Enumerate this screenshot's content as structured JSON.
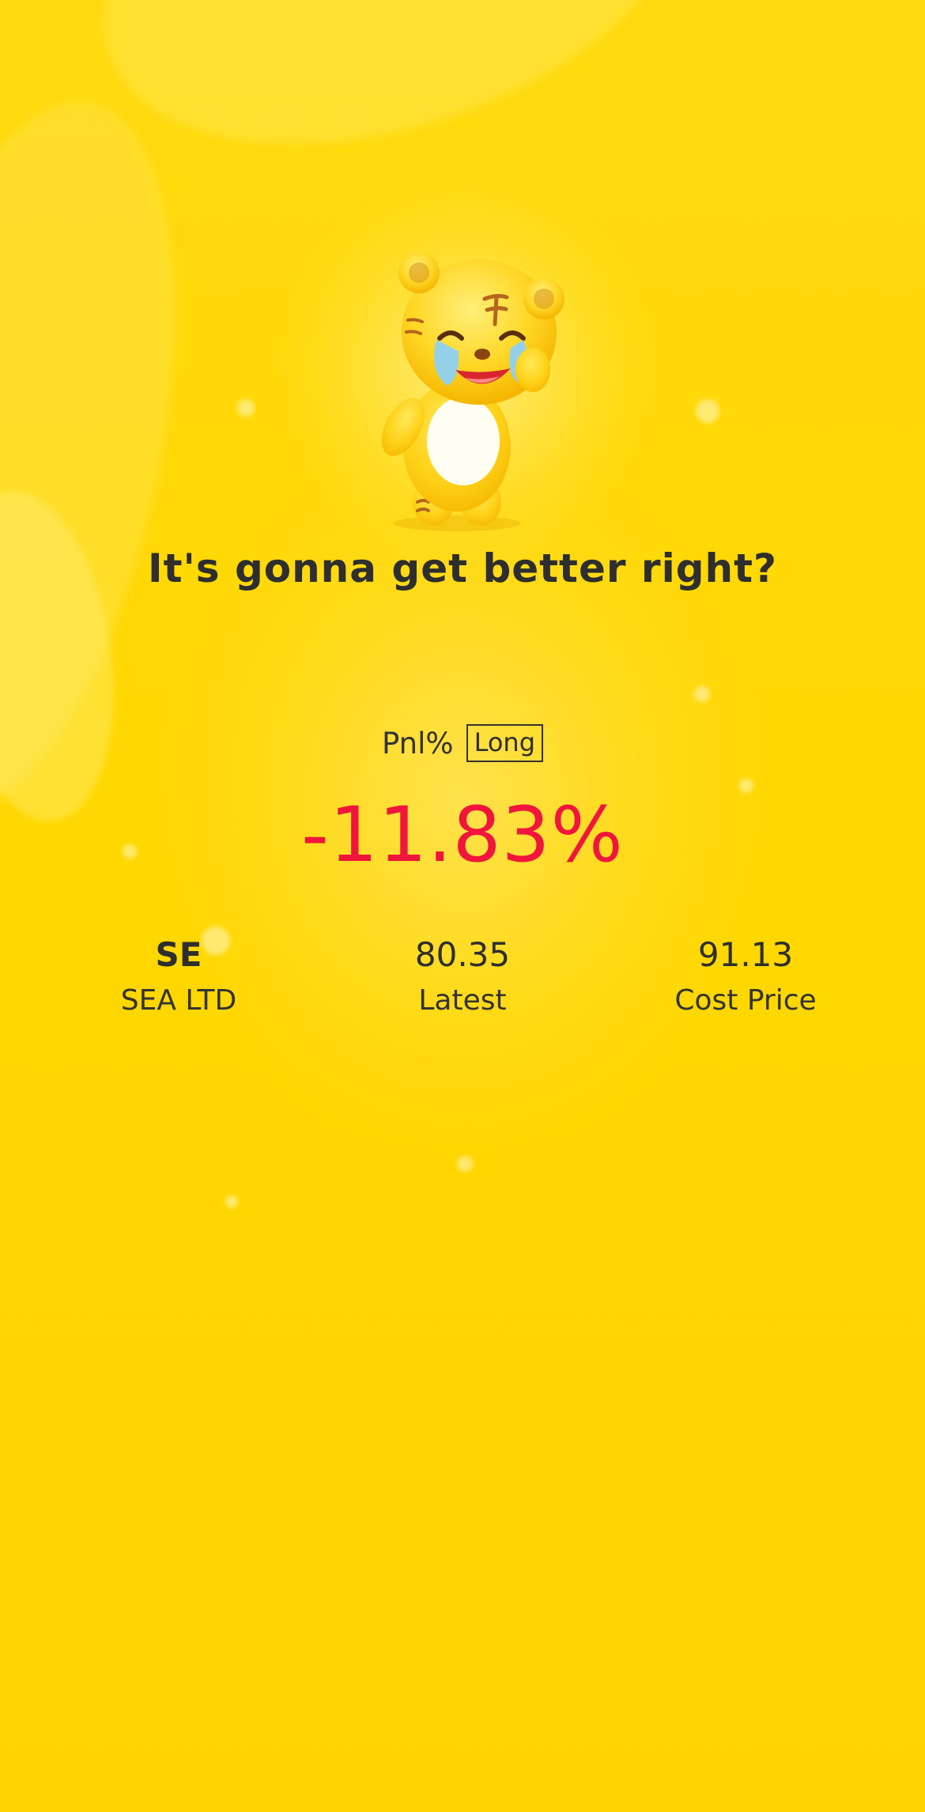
{
  "headline": "It's gonna get better right?",
  "pnl": {
    "label": "Pnl%",
    "position_type": "Long",
    "value": "-11.83%",
    "value_color": "#f0153c"
  },
  "stats": {
    "symbol": "SE",
    "company": "SEA LTD",
    "latest_value": "80.35",
    "latest_label": "Latest",
    "cost_value": "91.13",
    "cost_label": "Cost Price"
  },
  "colors": {
    "background": "#ffd600",
    "text": "#2e2e2e"
  },
  "icons": {
    "mascot": "crying-tiger-mascot"
  }
}
